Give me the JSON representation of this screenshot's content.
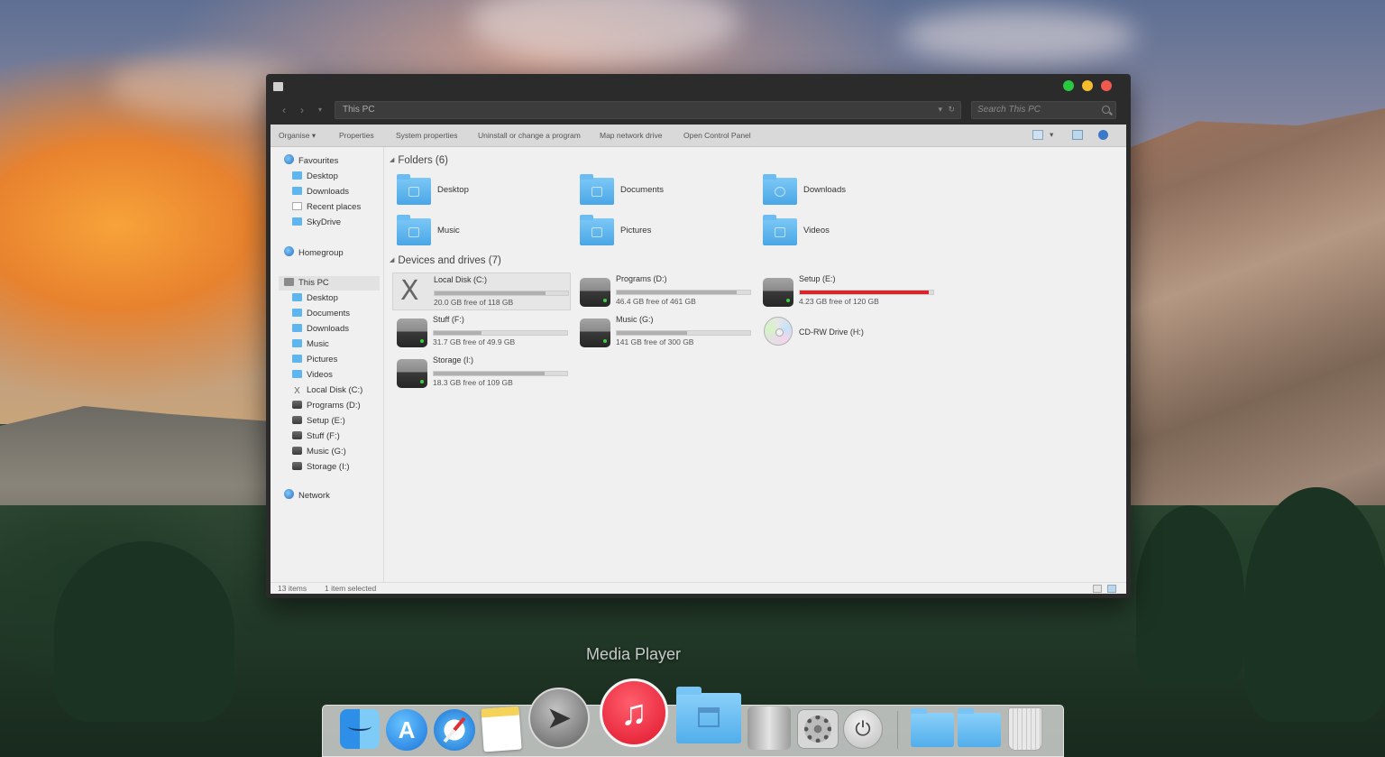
{
  "window": {
    "address": "This PC",
    "search_placeholder": "Search This PC"
  },
  "ribbon": {
    "items": [
      "Organise",
      "Properties",
      "System properties",
      "Uninstall or change a program",
      "Map network drive",
      "Open Control Panel"
    ]
  },
  "sidebar": {
    "favourites": "Favourites",
    "fav_items": [
      "Desktop",
      "Downloads",
      "Recent places",
      "SkyDrive"
    ],
    "homegroup": "Homegroup",
    "this_pc": "This PC",
    "pc_items": [
      "Desktop",
      "Documents",
      "Downloads",
      "Music",
      "Pictures",
      "Videos",
      "Local Disk (C:)",
      "Programs (D:)",
      "Setup (E:)",
      "Stuff (F:)",
      "Music (G:)",
      "Storage (I:)"
    ],
    "network": "Network"
  },
  "main": {
    "folders_header": "Folders (6)",
    "folders": [
      "Desktop",
      "Documents",
      "Downloads",
      "Music",
      "Pictures",
      "Videos"
    ],
    "drives_header": "Devices and drives (7)",
    "drives": [
      {
        "name": "Local Disk (C:)",
        "free": "20.0 GB free of 118 GB",
        "used_fraction": 0.83
      },
      {
        "name": "Programs (D:)",
        "free": "46.4 GB free of 461 GB",
        "used_fraction": 0.9
      },
      {
        "name": "Setup (E:)",
        "free": "4.23 GB free of 120 GB",
        "used_fraction": 0.965
      },
      {
        "name": "Stuff (F:)",
        "free": "31.7 GB free of 49.9 GB",
        "used_fraction": 0.36
      },
      {
        "name": "Music (G:)",
        "free": "141 GB free of 300 GB",
        "used_fraction": 0.53
      },
      {
        "name": "CD-RW Drive (H:)"
      },
      {
        "name": "Storage (I:)",
        "free": "18.3 GB free of 109 GB",
        "used_fraction": 0.83
      }
    ]
  },
  "status": {
    "items": "13 items",
    "selected": "1 item selected"
  },
  "dock": {
    "tooltip": "Media Player",
    "icons": [
      "finder-icon",
      "app-store-icon",
      "safari-icon",
      "notes-icon",
      "launchpad-icon",
      "itunes-icon",
      "applications-folder-icon",
      "mac-pro-icon",
      "system-preferences-icon",
      "power-icon",
      "documents-stack-icon",
      "downloads-stack-icon",
      "trash-icon"
    ]
  },
  "colors": {
    "accent_folder": "#5fb6ee",
    "low_space": "#d9242b",
    "led": "#3cd23c"
  }
}
